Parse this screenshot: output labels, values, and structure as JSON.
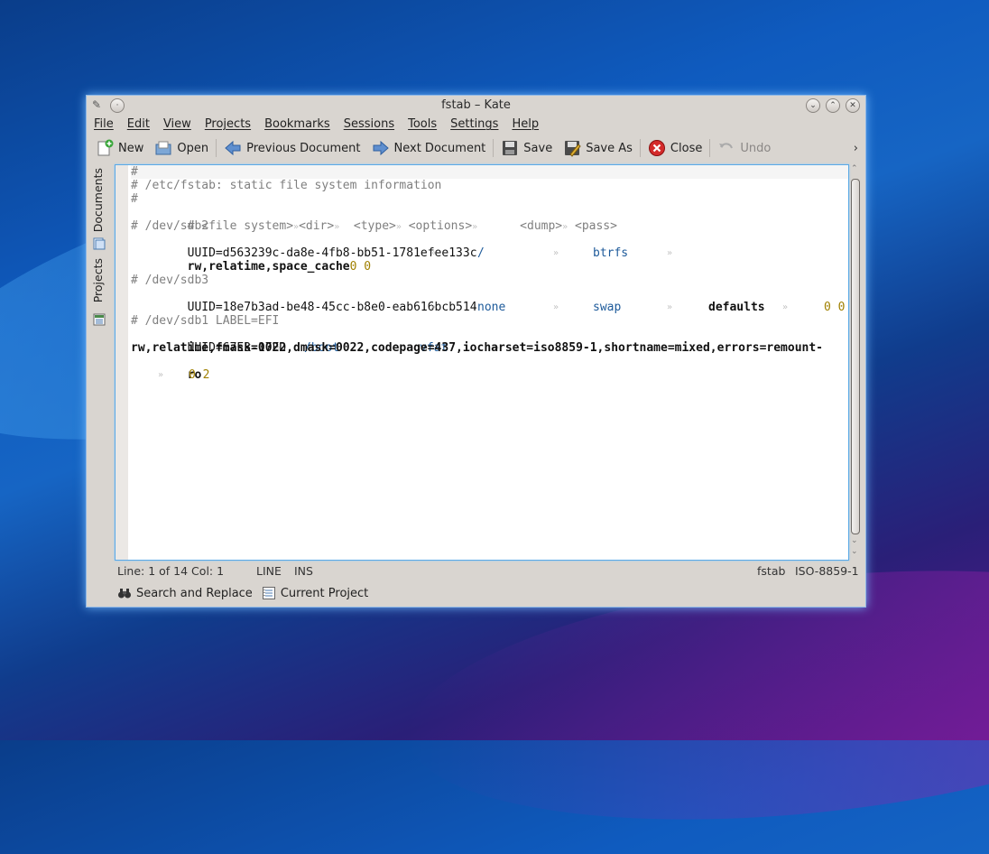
{
  "window": {
    "title": "fstab – Kate"
  },
  "menu": [
    "File",
    "Edit",
    "View",
    "Projects",
    "Bookmarks",
    "Sessions",
    "Tools",
    "Settings",
    "Help"
  ],
  "toolbar": {
    "new": "New",
    "open": "Open",
    "previous": "Previous Document",
    "next": "Next Document",
    "save": "Save",
    "save_as": "Save As",
    "close": "Close",
    "undo": "Undo",
    "more": "›"
  },
  "sidebar": {
    "documents": "Documents",
    "projects": "Projects"
  },
  "code": {
    "l1": "#",
    "l2": "# /etc/fstab: static file system information",
    "l3": "#",
    "l4a": "# <file system>",
    "l4b": "<dir>",
    "l4c": "<type>",
    "l4d": "<options>",
    "l4e": "<dump>",
    "l4f": "<pass>",
    "l5": "# /dev/sdb2",
    "l6a": "UUID=d563239c-da8e-4fb8-bb51-1781efee133c",
    "l6b": "/",
    "l6c": "btrfs",
    "l7a": "rw,relatime,space_cache",
    "l7b": "0 0",
    "l9": "# /dev/sdb3",
    "l10a": "UUID=18e7b3ad-be48-45cc-b8e0-eab616bcb514",
    "l10b": "none",
    "l10c": "swap",
    "l10d": "defaults",
    "l10e": "0 0",
    "l12": "# /dev/sdb1 LABEL=EFI",
    "l13a": "UUID=67E3-17ED",
    "l13b": "/boot",
    "l13c": "vfat",
    "l14a": "rw,relatime,fmask=0022,dmask=0022,codepage=437,iocharset=iso8859-1,shortname=mixed,errors=remount-",
    "l15a": "ro",
    "l15b": "0 2",
    "tabmark": "»"
  },
  "status": {
    "position": "Line: 1 of 14 Col: 1",
    "mode": "LINE",
    "insert": "INS",
    "filetype": "fstab",
    "encoding": "ISO-8859-1"
  },
  "bottom": {
    "search": "Search and Replace",
    "project": "Current Project"
  }
}
